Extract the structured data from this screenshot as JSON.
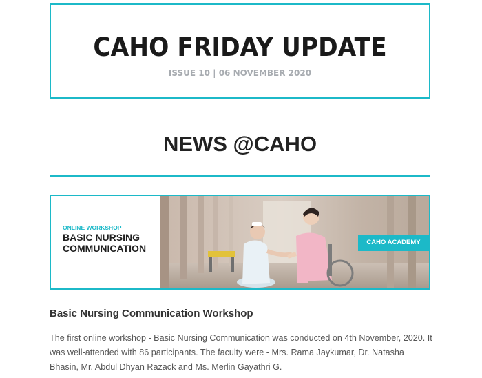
{
  "header": {
    "title": "CAHO FRIDAY UPDATE",
    "issue": "ISSUE 10 | 06 NOVEMBER 2020"
  },
  "section": {
    "heading": "NEWS @CAHO"
  },
  "banner": {
    "tag": "ONLINE WORKSHOP",
    "title_line1": "BASIC NURSING",
    "title_line2": "COMMUNICATION",
    "pill": "CAHO ACADEMY"
  },
  "article": {
    "title": "Basic Nursing Communication Workshop",
    "body": "The first online workshop - Basic Nursing Communication was conducted on 4th November, 2020. It was well-attended with 86 participants. The faculty were - Mrs. Rama Jaykumar, Dr. Natasha Bhasin, Mr. Abdul Dhyan Razack and Ms. Merlin Gayathri G."
  },
  "colors": {
    "accent": "#1cb9c8",
    "heading": "#222222",
    "body_text": "#555555"
  }
}
